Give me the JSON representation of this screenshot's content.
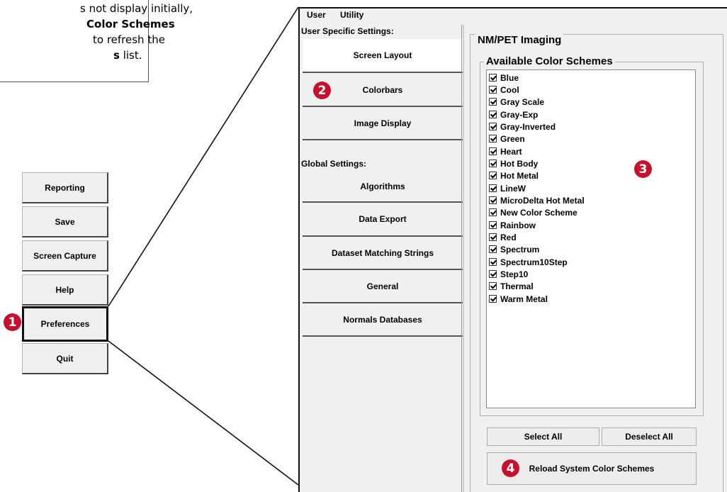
{
  "note": {
    "line1": "s not display initially,",
    "line2_bold": "Color Schemes",
    "line3": "to refresh the",
    "line4_bold": "s",
    "line4_rest": " list."
  },
  "left_menu": {
    "buttons": [
      {
        "label": "Reporting"
      },
      {
        "label": "Save"
      },
      {
        "label": "Screen Capture"
      },
      {
        "label": "Help"
      },
      {
        "label": "Preferences"
      },
      {
        "label": "Quit"
      }
    ]
  },
  "callouts": {
    "one": "1",
    "two": "2",
    "three": "3",
    "four": "4"
  },
  "dialog": {
    "menu": {
      "user": "User",
      "utility": "Utility"
    },
    "user_specific_label": "User Specific Settings:",
    "global_label": "Global Settings:",
    "user_tabs": [
      {
        "label": "Screen Layout"
      },
      {
        "label": "Colorbars"
      },
      {
        "label": "Image Display"
      }
    ],
    "global_tabs": [
      {
        "label": "Algorithms"
      },
      {
        "label": "Data Export"
      },
      {
        "label": "Dataset Matching Strings"
      },
      {
        "label": "General"
      },
      {
        "label": "Normals Databases"
      }
    ],
    "group_title": "NM/PET Imaging",
    "subgroup_title": "Available Color Schemes",
    "color_schemes": [
      {
        "label": "Blue",
        "checked": true
      },
      {
        "label": "Cool",
        "checked": true
      },
      {
        "label": "Gray Scale",
        "checked": true
      },
      {
        "label": "Gray-Exp",
        "checked": true
      },
      {
        "label": "Gray-Inverted",
        "checked": true
      },
      {
        "label": "Green",
        "checked": true
      },
      {
        "label": "Heart",
        "checked": true
      },
      {
        "label": "Hot Body",
        "checked": true
      },
      {
        "label": "Hot Metal",
        "checked": true
      },
      {
        "label": "LineW",
        "checked": true
      },
      {
        "label": "MicroDelta Hot Metal",
        "checked": true
      },
      {
        "label": "New Color Scheme",
        "checked": true
      },
      {
        "label": "Rainbow",
        "checked": true
      },
      {
        "label": "Red",
        "checked": true
      },
      {
        "label": "Spectrum",
        "checked": true
      },
      {
        "label": "Spectrum10Step",
        "checked": true
      },
      {
        "label": "Step10",
        "checked": true
      },
      {
        "label": "Thermal",
        "checked": true
      },
      {
        "label": "Warm Metal",
        "checked": true
      }
    ],
    "select_all": "Select All",
    "deselect_all": "Deselect All",
    "reload": "Reload System Color Schemes"
  },
  "colors": {
    "callout": "#c8102e"
  }
}
